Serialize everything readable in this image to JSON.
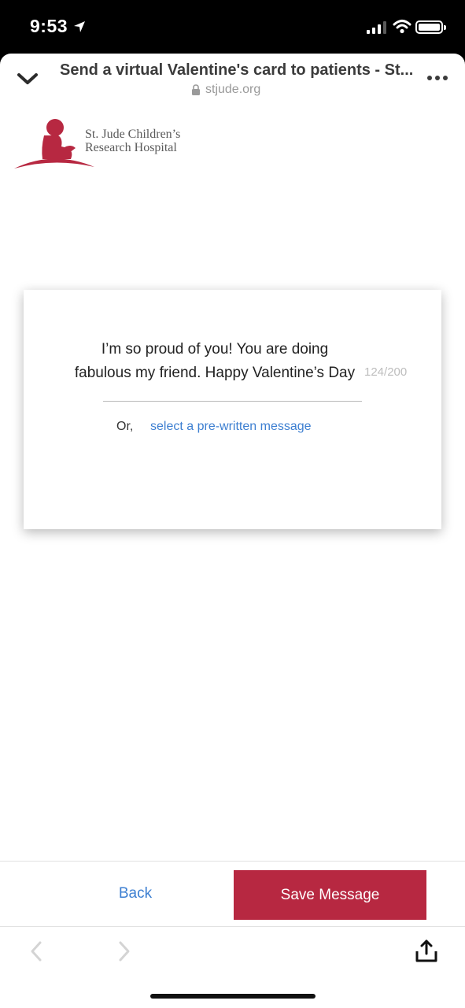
{
  "status_bar": {
    "time": "9:53",
    "icons": [
      "location-arrow-icon",
      "signal-icon",
      "wifi-icon",
      "battery-icon"
    ]
  },
  "browser": {
    "title": "Send a virtual Valentine's card to patients - St....",
    "url": "stjude.org",
    "icons": [
      "chevron-down-icon",
      "lock-icon",
      "more-icon"
    ]
  },
  "logo": {
    "line1": "St. Jude Children’s",
    "line2": "Research Hospital",
    "brand_color": "#b72841"
  },
  "card": {
    "message_line1": "I’m so proud of you! You are doing",
    "message_line2": "fabulous my friend. Happy Valentine’s Day",
    "char_counter": "124/200",
    "or_label": "Or,",
    "prewritten_link": "select a pre-written message"
  },
  "actions": {
    "back_label": "Back",
    "save_label": "Save Message",
    "save_color": "#b72841",
    "link_color": "#3d7fd1"
  },
  "toolbar": {
    "icons": [
      "chevron-left-icon",
      "chevron-right-icon",
      "share-icon"
    ]
  }
}
